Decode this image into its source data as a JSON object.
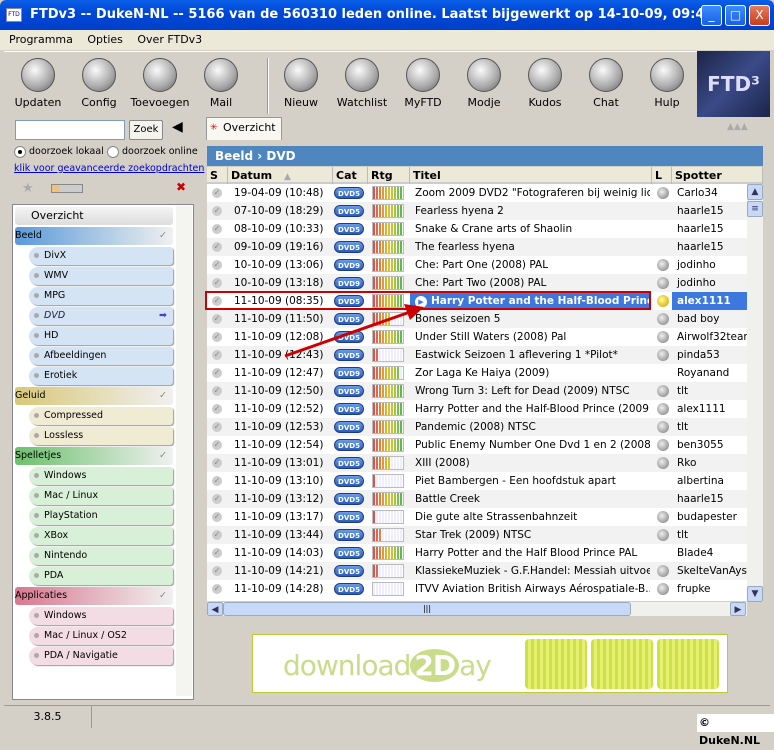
{
  "window": {
    "title": "FTDv3 -- DukeN-NL -- 5166 van de 560310 leden online. Laatst bijgewerkt op 14-10-09, 09:49.",
    "minimize": "_",
    "maximize": "□",
    "close": "X",
    "icon": "FTD"
  },
  "menu": [
    "Programma",
    "Opties",
    "Over FTDv3"
  ],
  "toolbar": {
    "left": [
      {
        "label": "Updaten",
        "icon": "update-icon"
      },
      {
        "label": "Config",
        "icon": "config-icon"
      },
      {
        "label": "Toevoegen",
        "icon": "add-icon"
      },
      {
        "label": "Mail",
        "icon": "mail-icon"
      }
    ],
    "right": [
      {
        "label": "Nieuw",
        "icon": "new-icon"
      },
      {
        "label": "Watchlist",
        "icon": "watchlist-icon"
      },
      {
        "label": "MyFTD",
        "icon": "myftd-icon"
      },
      {
        "label": "Modje",
        "icon": "exclamation-icon"
      },
      {
        "label": "Kudos",
        "icon": "hearts-icon"
      },
      {
        "label": "Chat",
        "icon": "chat-icon"
      },
      {
        "label": "Hulp",
        "icon": "help-icon"
      }
    ],
    "logo": "FTD³"
  },
  "search": {
    "value": "",
    "button": "Zoek",
    "radio_local": "doorzoek lokaal",
    "radio_online": "doorzoek online",
    "selected": "local",
    "advanced_link": "klik voor geavanceerde zoekopdrachten"
  },
  "tree": [
    {
      "label": "Overzicht",
      "type": "root"
    },
    {
      "label": "Beeld",
      "type": "group",
      "color": "#5a9ad8"
    },
    {
      "label": "DivX",
      "type": "sub",
      "color": "#d4e4f4"
    },
    {
      "label": "WMV",
      "type": "sub",
      "color": "#d4e4f4"
    },
    {
      "label": "MPG",
      "type": "sub",
      "color": "#d4e4f4"
    },
    {
      "label": "DVD",
      "type": "sub",
      "color": "#d4e4f4",
      "selected": true
    },
    {
      "label": "HD",
      "type": "sub",
      "color": "#d4e4f4"
    },
    {
      "label": "Afbeeldingen",
      "type": "sub",
      "color": "#d4e4f4"
    },
    {
      "label": "Erotiek",
      "type": "sub",
      "color": "#d4e4f4"
    },
    {
      "label": "Geluid",
      "type": "group",
      "color": "#d8c878"
    },
    {
      "label": "Compressed",
      "type": "sub",
      "color": "#f0ecd4"
    },
    {
      "label": "Lossless",
      "type": "sub",
      "color": "#f0ecd4"
    },
    {
      "label": "Spelletjes",
      "type": "group",
      "color": "#6cc06c"
    },
    {
      "label": "Windows",
      "type": "sub",
      "color": "#d8f0d8"
    },
    {
      "label": "Mac / Linux",
      "type": "sub",
      "color": "#d8f0d8"
    },
    {
      "label": "PlayStation",
      "type": "sub",
      "color": "#d8f0d8"
    },
    {
      "label": "XBox",
      "type": "sub",
      "color": "#d8f0d8"
    },
    {
      "label": "Nintendo",
      "type": "sub",
      "color": "#d8f0d8"
    },
    {
      "label": "PDA",
      "type": "sub",
      "color": "#d8f0d8"
    },
    {
      "label": "Applicaties",
      "type": "group",
      "color": "#d87890"
    },
    {
      "label": "Windows",
      "type": "sub",
      "color": "#f4dce4"
    },
    {
      "label": "Mac / Linux / OS2",
      "type": "sub",
      "color": "#f4dce4"
    },
    {
      "label": "PDA / Navigatie",
      "type": "sub",
      "color": "#f4dce4"
    }
  ],
  "tab": {
    "label": "Overzicht"
  },
  "breadcrumb": "Beeld › DVD",
  "columns": [
    "S",
    "Datum",
    "Cat",
    "Rtg",
    "Titel",
    "L",
    "Spotter"
  ],
  "sort_indicator": "▲",
  "rows": [
    {
      "date": "19-04-09 (10:48)",
      "cat": "DVD5",
      "rating": 10,
      "title": "Zoom 2009 DVD2 \"Fotograferen bij weinig licht\"",
      "l": true,
      "spotter": "Carlo34"
    },
    {
      "date": "07-10-09 (18:29)",
      "cat": "DVD5",
      "rating": 10,
      "title": "Fearless hyena 2",
      "l": false,
      "spotter": "haarle15"
    },
    {
      "date": "08-10-09 (10:33)",
      "cat": "DVD5",
      "rating": 10,
      "title": "Snake & Crane arts of Shaolin",
      "l": false,
      "spotter": "haarle15"
    },
    {
      "date": "09-10-09 (19:16)",
      "cat": "DVD5",
      "rating": 10,
      "title": "The fearless hyena",
      "l": false,
      "spotter": "haarle15"
    },
    {
      "date": "10-10-09 (13:06)",
      "cat": "DVD9",
      "rating": 10,
      "title": "Che: Part One (2008) PAL",
      "l": true,
      "spotter": "jodinho"
    },
    {
      "date": "10-10-09 (13:18)",
      "cat": "DVD9",
      "rating": 10,
      "title": "Che: Part Two (2008) PAL",
      "l": true,
      "spotter": "jodinho"
    },
    {
      "date": "11-10-09 (08:35)",
      "cat": "DVD5",
      "rating": 10,
      "title": "Harry Potter and the Half-Blood Prince ...",
      "l": true,
      "spotter": "alex1111",
      "selected": true
    },
    {
      "date": "11-10-09 (11:50)",
      "cat": "DVD5",
      "rating": 6,
      "title": "Bones seizoen 5",
      "l": true,
      "spotter": "bad boy"
    },
    {
      "date": "11-10-09 (12:08)",
      "cat": "DVD5",
      "rating": 10,
      "title": "Under Still Waters (2008) Pal",
      "l": true,
      "spotter": "Airwolf32team"
    },
    {
      "date": "11-10-09 (12:43)",
      "cat": "DVD5",
      "rating": 2,
      "title": "Eastwick Seizoen 1 aflevering 1 *Pilot*",
      "l": true,
      "spotter": "pinda53"
    },
    {
      "date": "11-10-09 (12:47)",
      "cat": "DVD9",
      "rating": 9,
      "title": "Zor Laga Ke Haiya (2009)",
      "l": false,
      "spotter": "Royanand"
    },
    {
      "date": "11-10-09 (12:50)",
      "cat": "DVD5",
      "rating": 10,
      "title": "Wrong Turn 3: Left for Dead (2009) NTSC",
      "l": true,
      "spotter": "tlt"
    },
    {
      "date": "11-10-09 (12:52)",
      "cat": "DVD5",
      "rating": 10,
      "title": "Harry Potter and the Half-Blood Prince (2009)",
      "l": true,
      "spotter": "alex1111"
    },
    {
      "date": "11-10-09 (12:53)",
      "cat": "DVD5",
      "rating": 10,
      "title": "Pandemic (2008) NTSC",
      "l": true,
      "spotter": "tlt"
    },
    {
      "date": "11-10-09 (12:54)",
      "cat": "DVD5",
      "rating": 10,
      "title": "Public Enemy Number One Dvd 1 en 2 (2008)",
      "l": true,
      "spotter": "ben3055"
    },
    {
      "date": "11-10-09 (13:01)",
      "cat": "DVD5",
      "rating": 6,
      "title": "XIII (2008)",
      "l": true,
      "spotter": "Rko"
    },
    {
      "date": "11-10-09 (13:10)",
      "cat": "DVD5",
      "rating": 1,
      "title": "Piet Bambergen - Een hoofdstuk apart",
      "l": false,
      "spotter": "albertina"
    },
    {
      "date": "11-10-09 (13:12)",
      "cat": "DVD5",
      "rating": 10,
      "title": "Battle Creek",
      "l": false,
      "spotter": "haarle15"
    },
    {
      "date": "11-10-09 (13:17)",
      "cat": "DVD5",
      "rating": 1,
      "title": "Die gute alte Strassenbahnzeit",
      "l": true,
      "spotter": "budapester"
    },
    {
      "date": "11-10-09 (13:44)",
      "cat": "DVD5",
      "rating": 3,
      "title": "Star Trek (2009) NTSC",
      "l": true,
      "spotter": "tlt"
    },
    {
      "date": "11-10-09 (14:03)",
      "cat": "DVD5",
      "rating": 10,
      "title": "Harry Potter and the Half Blood Prince PAL",
      "l": false,
      "spotter": "Blade4"
    },
    {
      "date": "11-10-09 (14:21)",
      "cat": "DVD5",
      "rating": 2,
      "title": "KlassiekeMuziek - G.F.Handel: Messiah uitvoer...",
      "l": true,
      "spotter": "SkelteVanAys"
    },
    {
      "date": "11-10-09 (14:28)",
      "cat": "DVD5",
      "rating": 0,
      "title": "ITVV Aviation British Airways Aérospatiale-B...",
      "l": true,
      "spotter": "frupke"
    }
  ],
  "ad": {
    "text_a": "download",
    "text_b": "2D",
    "text_c": "ay"
  },
  "status": {
    "version": "3.8.5"
  },
  "watermark": "© DukeN.NL",
  "colors": {
    "titlebar": "#0048d8",
    "breadcrumb": "#4f86c0",
    "selection": "#3c78e0",
    "annotation": "#cc0000"
  }
}
